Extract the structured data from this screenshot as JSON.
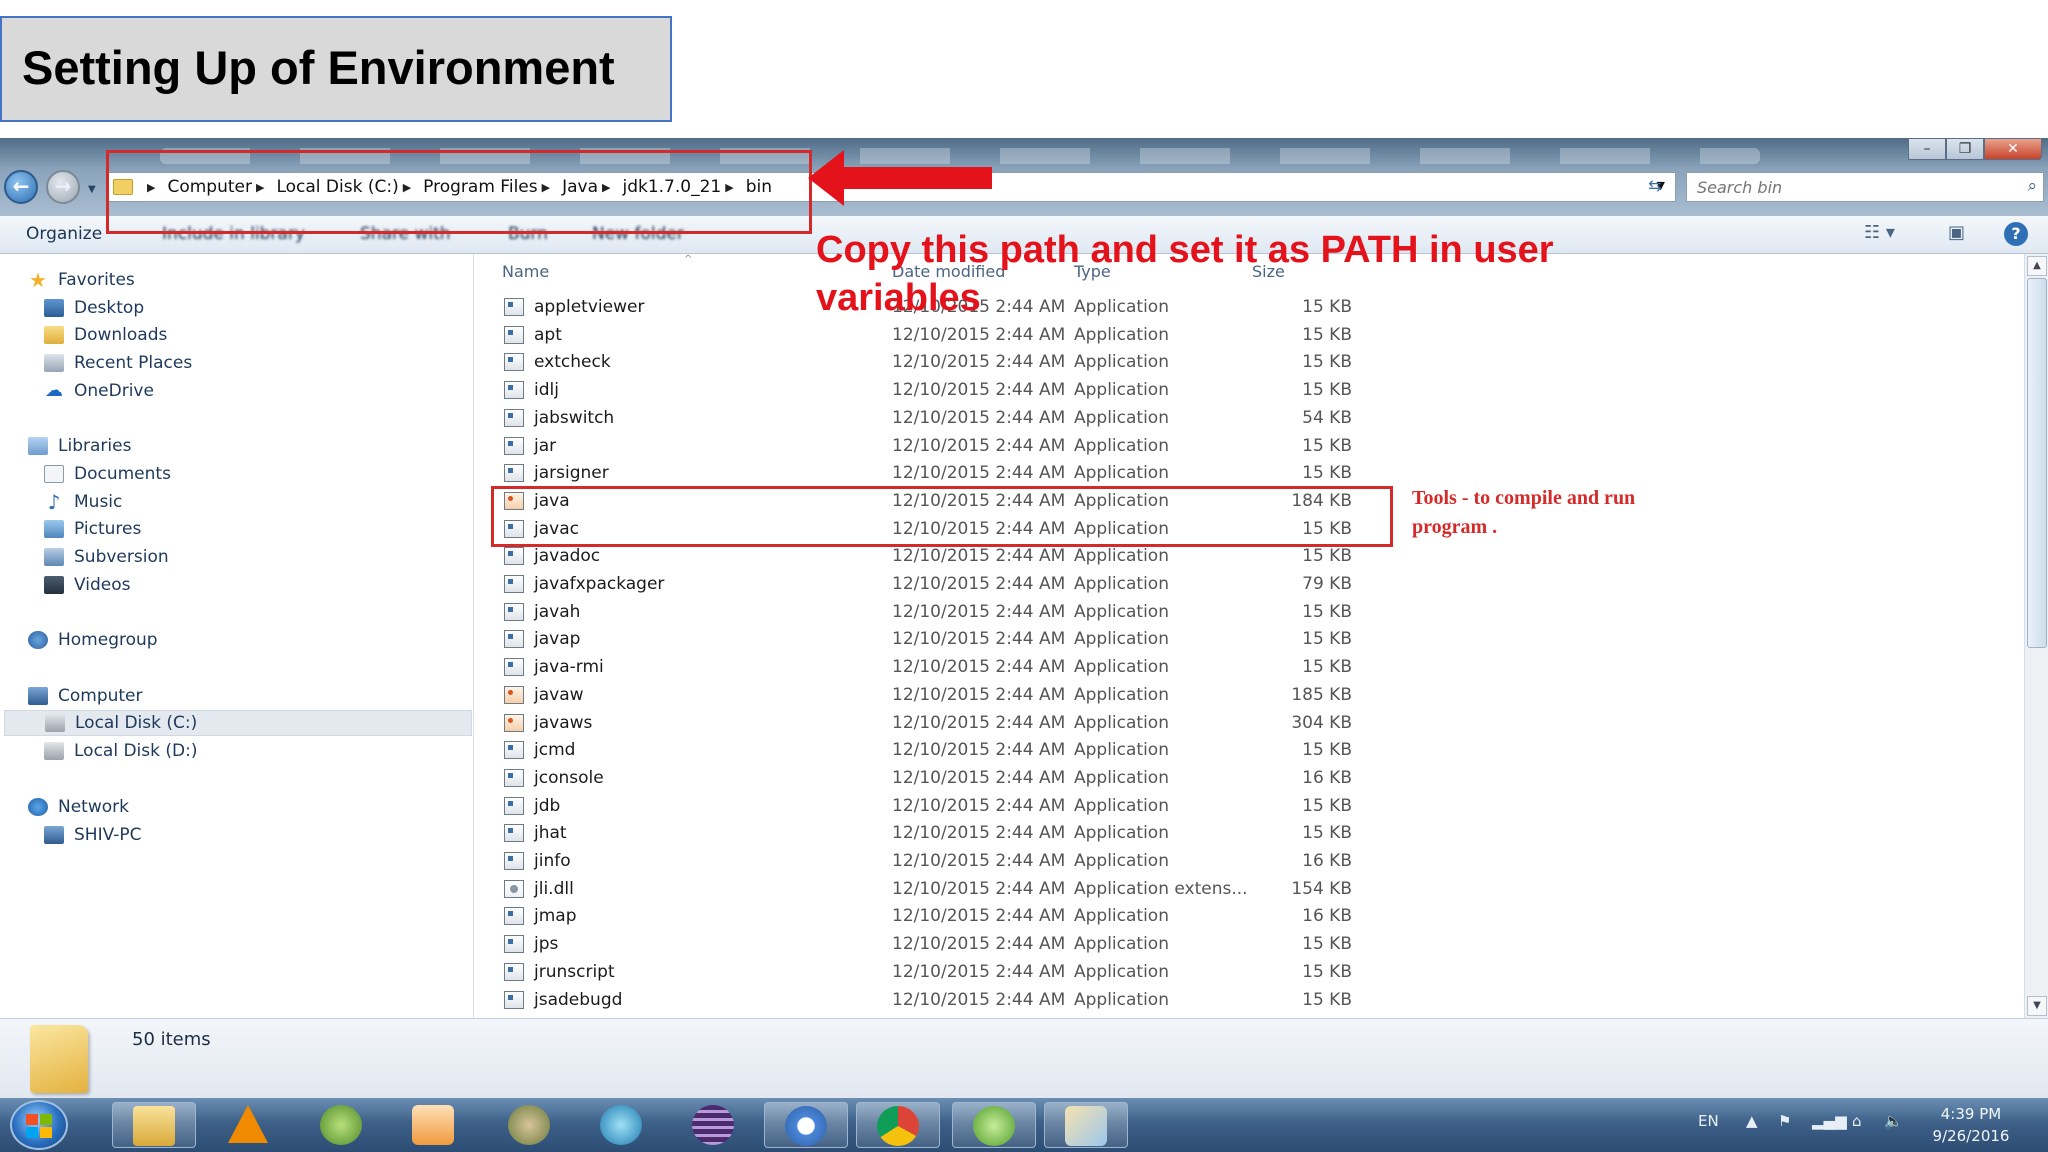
{
  "slide": {
    "title": "Setting Up of Environment"
  },
  "window": {
    "address": {
      "crumbs": [
        "Computer",
        "Local Disk (C:)",
        "Program Files",
        "Java",
        "jdk1.7.0_21",
        "bin"
      ]
    },
    "search": {
      "placeholder": "Search bin"
    },
    "toolbar": {
      "organize": "Organize",
      "include": "Include in library",
      "share": "Share with",
      "burn": "Burn",
      "new_folder": "New folder"
    },
    "nav": {
      "favorites": "Favorites",
      "desktop": "Desktop",
      "downloads": "Downloads",
      "recent": "Recent Places",
      "onedrive": "OneDrive",
      "libraries": "Libraries",
      "documents": "Documents",
      "music": "Music",
      "pictures": "Pictures",
      "subversion": "Subversion",
      "videos": "Videos",
      "homegroup": "Homegroup",
      "computer": "Computer",
      "local_c": "Local Disk (C:)",
      "local_d": "Local Disk (D:)",
      "network": "Network",
      "shiv_pc": "SHIV-PC"
    },
    "columns": {
      "name": "Name",
      "date": "Date modified",
      "type": "Type",
      "size": "Size"
    },
    "files": [
      {
        "name": "appletviewer",
        "date": "12/10/2015 2:44 AM",
        "type": "Application",
        "size": "15 KB",
        "icon": "exe"
      },
      {
        "name": "apt",
        "date": "12/10/2015 2:44 AM",
        "type": "Application",
        "size": "15 KB",
        "icon": "exe"
      },
      {
        "name": "extcheck",
        "date": "12/10/2015 2:44 AM",
        "type": "Application",
        "size": "15 KB",
        "icon": "exe"
      },
      {
        "name": "idlj",
        "date": "12/10/2015 2:44 AM",
        "type": "Application",
        "size": "15 KB",
        "icon": "exe"
      },
      {
        "name": "jabswitch",
        "date": "12/10/2015 2:44 AM",
        "type": "Application",
        "size": "54 KB",
        "icon": "exe"
      },
      {
        "name": "jar",
        "date": "12/10/2015 2:44 AM",
        "type": "Application",
        "size": "15 KB",
        "icon": "exe"
      },
      {
        "name": "jarsigner",
        "date": "12/10/2015 2:44 AM",
        "type": "Application",
        "size": "15 KB",
        "icon": "exe"
      },
      {
        "name": "java",
        "date": "12/10/2015 2:44 AM",
        "type": "Application",
        "size": "184 KB",
        "icon": "java"
      },
      {
        "name": "javac",
        "date": "12/10/2015 2:44 AM",
        "type": "Application",
        "size": "15 KB",
        "icon": "exe"
      },
      {
        "name": "javadoc",
        "date": "12/10/2015 2:44 AM",
        "type": "Application",
        "size": "15 KB",
        "icon": "exe"
      },
      {
        "name": "javafxpackager",
        "date": "12/10/2015 2:44 AM",
        "type": "Application",
        "size": "79 KB",
        "icon": "exe"
      },
      {
        "name": "javah",
        "date": "12/10/2015 2:44 AM",
        "type": "Application",
        "size": "15 KB",
        "icon": "exe"
      },
      {
        "name": "javap",
        "date": "12/10/2015 2:44 AM",
        "type": "Application",
        "size": "15 KB",
        "icon": "exe"
      },
      {
        "name": "java-rmi",
        "date": "12/10/2015 2:44 AM",
        "type": "Application",
        "size": "15 KB",
        "icon": "exe"
      },
      {
        "name": "javaw",
        "date": "12/10/2015 2:44 AM",
        "type": "Application",
        "size": "185 KB",
        "icon": "java"
      },
      {
        "name": "javaws",
        "date": "12/10/2015 2:44 AM",
        "type": "Application",
        "size": "304 KB",
        "icon": "java"
      },
      {
        "name": "jcmd",
        "date": "12/10/2015 2:44 AM",
        "type": "Application",
        "size": "15 KB",
        "icon": "exe"
      },
      {
        "name": "jconsole",
        "date": "12/10/2015 2:44 AM",
        "type": "Application",
        "size": "16 KB",
        "icon": "exe"
      },
      {
        "name": "jdb",
        "date": "12/10/2015 2:44 AM",
        "type": "Application",
        "size": "15 KB",
        "icon": "exe"
      },
      {
        "name": "jhat",
        "date": "12/10/2015 2:44 AM",
        "type": "Application",
        "size": "15 KB",
        "icon": "exe"
      },
      {
        "name": "jinfo",
        "date": "12/10/2015 2:44 AM",
        "type": "Application",
        "size": "16 KB",
        "icon": "exe"
      },
      {
        "name": "jli.dll",
        "date": "12/10/2015 2:44 AM",
        "type": "Application extens...",
        "size": "154 KB",
        "icon": "dll"
      },
      {
        "name": "jmap",
        "date": "12/10/2015 2:44 AM",
        "type": "Application",
        "size": "16 KB",
        "icon": "exe"
      },
      {
        "name": "jps",
        "date": "12/10/2015 2:44 AM",
        "type": "Application",
        "size": "15 KB",
        "icon": "exe"
      },
      {
        "name": "jrunscript",
        "date": "12/10/2015 2:44 AM",
        "type": "Application",
        "size": "15 KB",
        "icon": "exe"
      },
      {
        "name": "jsadebugd",
        "date": "12/10/2015 2:44 AM",
        "type": "Application",
        "size": "15 KB",
        "icon": "exe"
      }
    ],
    "status": {
      "items": "50 items"
    }
  },
  "taskbar": {
    "lang": "EN",
    "time": "4:39 PM",
    "date": "9/26/2016"
  },
  "annotations": {
    "path_note": "Copy this path and set it as PATH in user variables",
    "tools_note": "Tools - to compile and run program ."
  },
  "colors": {
    "annotation_red": "#e4121b",
    "title_bg": "#d9d9d9",
    "title_border": "#4472c4"
  }
}
